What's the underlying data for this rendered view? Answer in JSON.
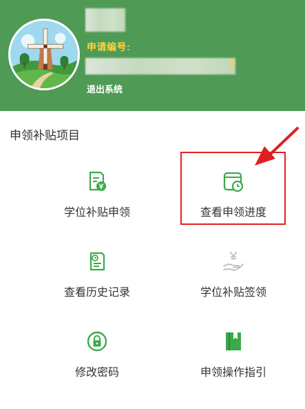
{
  "header": {
    "app_label": "申请编号:",
    "id_tail": "3",
    "logout_label": "退出系统"
  },
  "section": {
    "title": "申领补贴项目"
  },
  "tiles": [
    {
      "label": "学位补贴申领",
      "icon": "subsidy-apply-icon"
    },
    {
      "label": "查看申领进度",
      "icon": "progress-clock-icon"
    },
    {
      "label": "查看历史记录",
      "icon": "history-record-icon"
    },
    {
      "label": "学位补贴签领",
      "icon": "sign-receive-icon"
    },
    {
      "label": "修改密码",
      "icon": "lock-password-icon"
    },
    {
      "label": "申领操作指引",
      "icon": "guide-book-icon"
    }
  ],
  "colors": {
    "header_bg": "#4f9a55",
    "accent_yellow": "#ffd23a",
    "icon_green": "#3aaa4a",
    "highlight_red": "#e02020"
  }
}
